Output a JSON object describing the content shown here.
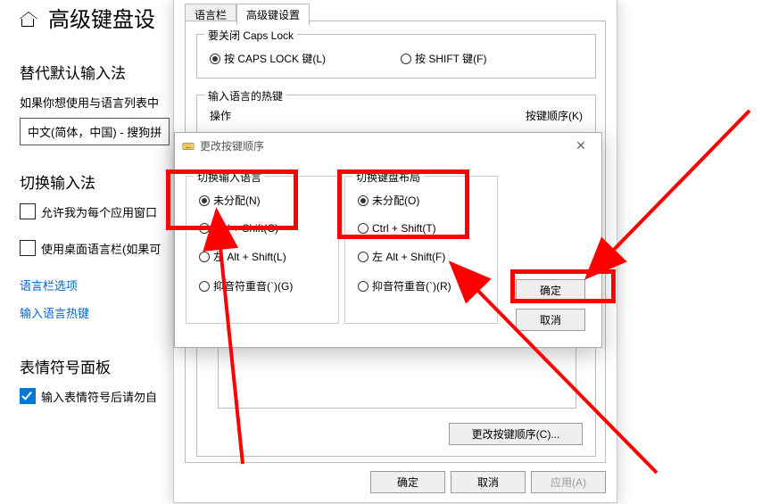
{
  "page": {
    "title": "高级键盘设"
  },
  "left": {
    "replace_h": "替代默认输入法",
    "replace_desc": "如果你想使用与语言列表中",
    "select_value": "中文(简体，中国) - 搜狗拼",
    "switch_h": "切换输入法",
    "cb1": "允许我为每个应用窗口",
    "cb2": "使用桌面语言栏(如果可",
    "link1": "语言栏选项",
    "link2": "输入语言热键",
    "emoji_h": "表情符号面板",
    "cb3": "输入表情符号后请勿自"
  },
  "big": {
    "tab1": "语言栏",
    "tab2": "高级键设置",
    "group1_title": "要关闭 Caps Lock",
    "g1_r1": "按 CAPS LOCK 键(L)",
    "g1_r2": "按 SHIFT 键(F)",
    "group2_title": "输入语言的热键",
    "g2_col1": "操作",
    "g2_col2": "按键顺序(K)",
    "change_seq_btn": "更改按键顺序(C)...",
    "ok": "确定",
    "cancel": "取消",
    "apply": "应用(A)"
  },
  "small": {
    "title": "更改按键顺序",
    "col1_title": "切换输入语言",
    "col2_title": "切换键盘布局",
    "c1_r1": "未分配(N)",
    "c1_r2": "Ctrl + Shift(C)",
    "c1_r3": "左 Alt + Shift(L)",
    "c1_r4": "抑音符重音(`)(G)",
    "c2_r1": "未分配(O)",
    "c2_r2": "Ctrl + Shift(T)",
    "c2_r3": "左 Alt + Shift(F)",
    "c2_r4": "抑音符重音(`)(R)",
    "ok": "确定",
    "cancel": "取消"
  }
}
